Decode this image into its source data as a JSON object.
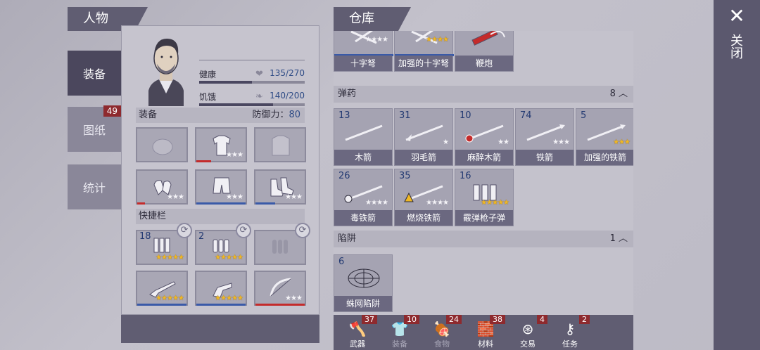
{
  "character_panel": {
    "title": "人物",
    "tabs": [
      {
        "label": "装备",
        "active": true,
        "badge": ""
      },
      {
        "label": "图纸",
        "active": false,
        "badge": "49"
      },
      {
        "label": "统计",
        "active": false,
        "badge": ""
      }
    ],
    "stats": [
      {
        "label": "健康",
        "value": "135/270",
        "icon": "heart-icon",
        "level": 0.5
      },
      {
        "label": "饥饿",
        "value": "140/200",
        "icon": "stomach-icon",
        "level": 0.7
      }
    ],
    "equipment": {
      "label": "装备",
      "defense_label": "防御力：",
      "defense_value": "80",
      "slots": [
        {
          "name": "hat",
          "stars": "",
          "durability": 0
        },
        {
          "name": "shirt",
          "stars": "★★★",
          "durability": 0.3,
          "durability_color": "red"
        },
        {
          "name": "jacket",
          "stars": "",
          "durability": 0
        },
        {
          "name": "gloves",
          "stars": "★★★",
          "durability": 0.15,
          "durability_color": "red"
        },
        {
          "name": "pants",
          "stars": "★★★",
          "durability": 1.0
        },
        {
          "name": "boots",
          "stars": "★★★",
          "durability": 0.4
        }
      ]
    },
    "hotbar": {
      "label": "快捷栏",
      "slots": [
        {
          "name": "shotgun-shells",
          "count": "18",
          "stars": "★★★★★",
          "gold": true
        },
        {
          "name": "pistol-rounds",
          "count": "2",
          "stars": "★★★★★",
          "gold": true
        },
        {
          "name": "empty-ammo",
          "count": "",
          "stars": "",
          "gold": false
        },
        {
          "name": "shotgun",
          "count": "",
          "stars": "★★★★★",
          "gold": true
        },
        {
          "name": "revolver",
          "count": "",
          "stars": "★★★★★",
          "gold": true
        },
        {
          "name": "bow",
          "count": "",
          "stars": "★★★",
          "gold": false
        }
      ]
    }
  },
  "storage_panel": {
    "title": "仓库",
    "top_row": [
      {
        "name": "十字弩",
        "stars": "★★★★",
        "gold": false
      },
      {
        "name": "加强的十字弩",
        "stars": "★★★★",
        "gold": true
      },
      {
        "name": "鞭炮",
        "stars": "",
        "gold": false
      }
    ],
    "ammo": {
      "label": "弹药",
      "count": "8",
      "items": [
        {
          "name": "木箭",
          "count": "13",
          "stars": "",
          "gold": false
        },
        {
          "name": "羽毛箭",
          "count": "31",
          "stars": "★",
          "gold": false
        },
        {
          "name": "麻醉木箭",
          "count": "10",
          "stars": "★★",
          "gold": false
        },
        {
          "name": "铁箭",
          "count": "74",
          "stars": "★★★",
          "gold": false
        },
        {
          "name": "加强的铁箭",
          "count": "5",
          "stars": "★★★",
          "gold": true
        },
        {
          "name": "毒铁箭",
          "count": "26",
          "stars": "★★★★",
          "gold": false
        },
        {
          "name": "燃烧铁箭",
          "count": "35",
          "stars": "★★★★",
          "gold": false
        },
        {
          "name": "霰弹枪子弹",
          "count": "16",
          "stars": "★★★★★",
          "gold": true
        }
      ]
    },
    "traps": {
      "label": "陷阱",
      "count": "1",
      "items": [
        {
          "name": "蛛网陷阱",
          "count": "6",
          "stars": "",
          "gold": false
        }
      ]
    },
    "bottom_tabs": [
      {
        "label": "武器",
        "badge": "37",
        "icon": "axe-icon",
        "dim": false
      },
      {
        "label": "装备",
        "badge": "10",
        "icon": "shirt-icon",
        "dim": true
      },
      {
        "label": "食物",
        "badge": "24",
        "icon": "food-icon",
        "dim": true
      },
      {
        "label": "材料",
        "badge": "38",
        "icon": "materials-icon",
        "dim": false
      },
      {
        "label": "交易",
        "badge": "4",
        "icon": "coin-icon",
        "dim": false
      },
      {
        "label": "任务",
        "badge": "2",
        "icon": "key-icon",
        "dim": false
      }
    ]
  },
  "close": {
    "label": "关闭",
    "icon": "close-icon"
  },
  "colors": {
    "gold_star": "#f0b823",
    "panel_dark": "#605d72",
    "badge_red": "#8e2a2e",
    "count_blue": "#233a72"
  }
}
